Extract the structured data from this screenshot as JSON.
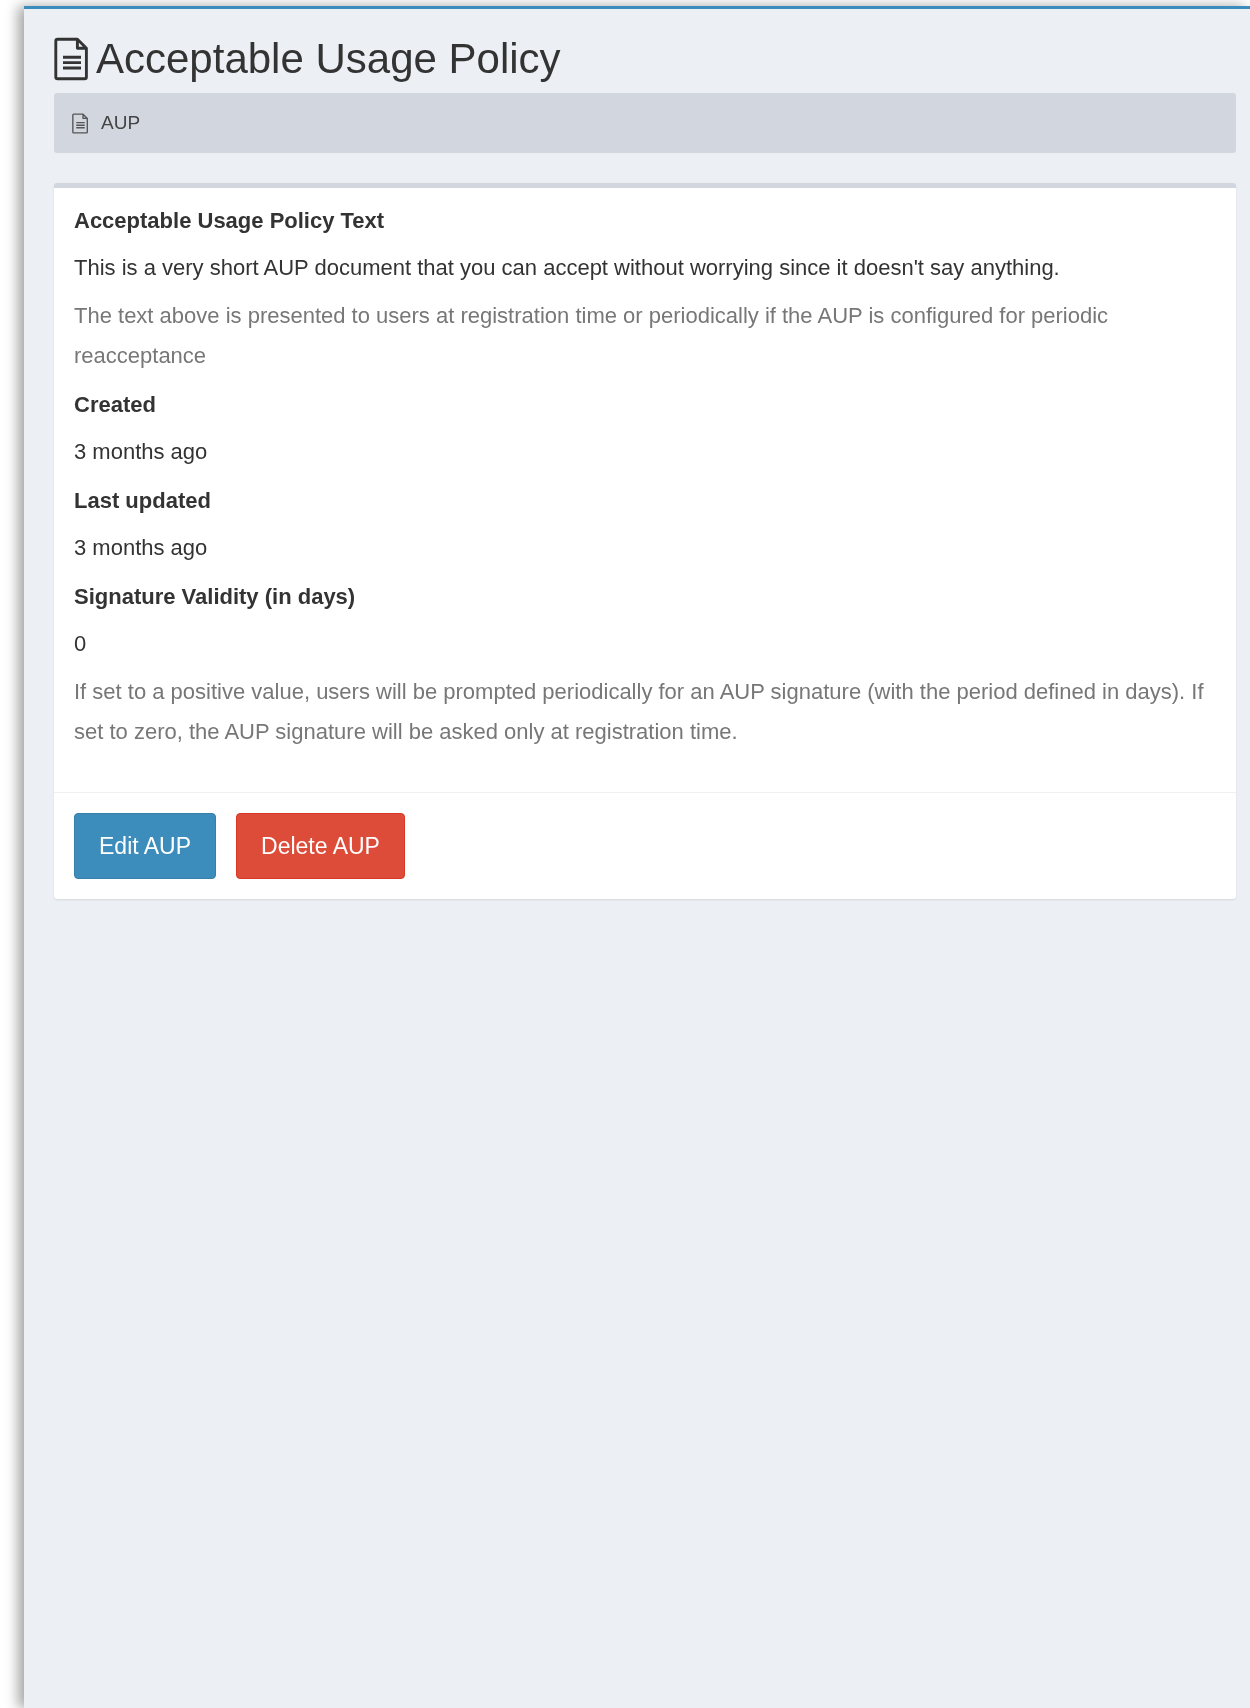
{
  "page_title": "Acceptable Usage Policy",
  "breadcrumb": [
    {
      "label": "AUP"
    }
  ],
  "details": [
    {
      "label": "Acceptable Usage Policy Text",
      "value": "This is a very short AUP document that you can accept without worrying since it doesn't say anything.",
      "help": "The text above is presented to users at registration time or periodically if the AUP is configured for periodic reacceptance"
    },
    {
      "label": "Created",
      "value": "3 months ago"
    },
    {
      "label": "Last updated",
      "value": "3 months ago"
    },
    {
      "label": "Signature Validity (in days)",
      "value": "0",
      "help": "If set to a positive value, users will be prompted periodically for an AUP signature (with the period defined in days). If set to zero, the AUP signature will be asked only at registration time."
    }
  ],
  "buttons": [
    {
      "label": "Edit AUP",
      "kind": "primary"
    },
    {
      "label": "Delete AUP",
      "kind": "danger"
    }
  ]
}
